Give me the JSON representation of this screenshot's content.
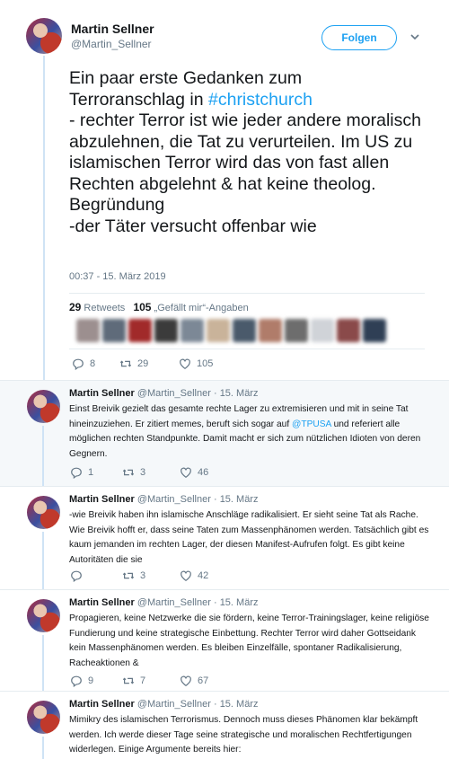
{
  "main": {
    "name": "Martin Sellner",
    "handle": "@Martin_Sellner",
    "follow_label": "Folgen",
    "text_before": "Ein paar erste Gedanken zum\nTerroranschlag in ",
    "hashtag": "#christchurch",
    "text_after": "\n- rechter Terror ist wie jeder andere moralisch abzulehnen, die Tat zu verurteilen. Im US zu islamischen Terror wird das von fast allen Rechten abgelehnt & hat keine theolog. Begründung\n-der Täter versucht offenbar wie",
    "timestamp": "00:37 - 15. März 2019",
    "retweets_count": "29",
    "retweets_label": "Retweets",
    "likes_count": "105",
    "likes_label": "„Gefällt mir“-Angaben",
    "reply_count": "8",
    "retweet_count": "29",
    "like_count": "105",
    "liker_colors": [
      "#9c8f8f",
      "#5f6b7a",
      "#a12a2a",
      "#3b3b3b",
      "#7c8896",
      "#c9b39a",
      "#4a5a6b",
      "#b07c6a",
      "#6d6d6d",
      "#d0d3d8",
      "#8a4a4a",
      "#2f3f55"
    ]
  },
  "replies": [
    {
      "name": "Martin Sellner",
      "handle": "@Martin_Sellner",
      "date": "· 15. März",
      "text_before": "Einst Breivik gezielt das gesamte rechte Lager zu extremisieren und mit in seine Tat hineinzuziehen. Er zitiert memes, beruft sich sogar auf ",
      "mention": "@TPUSA",
      "text_after": " und referiert alle möglichen rechten Standpunkte. Damit macht er sich zum nützlichen Idioten von deren Gegnern.",
      "reply_count": "1",
      "retweet_count": "3",
      "like_count": "46"
    },
    {
      "name": "Martin Sellner",
      "handle": "@Martin_Sellner",
      "date": "· 15. März",
      "text": "-wie Breivik haben ihn islamische Anschläge radikalisiert. Er sieht seine Tat als Rache. Wie Breivik hofft er, dass seine Taten zum Massenphänomen werden. Tatsächlich gibt es kaum jemanden im rechten Lager, der diesen Manifest-Aufrufen folgt. Es gibt keine Autoritäten die sie",
      "reply_count": "",
      "retweet_count": "3",
      "like_count": "42"
    },
    {
      "name": "Martin Sellner",
      "handle": "@Martin_Sellner",
      "date": "· 15. März",
      "text": "Propagieren, keine Netzwerke die sie fördern, keine Terror-Trainingslager, keine religiöse Fundierung und keine strategische Einbettung. Rechter Terror wird daher Gottseidank kein Massenphänomen werden. Es bleiben Einzelfälle, spontaner Radikalisierung, Racheaktionen &",
      "reply_count": "9",
      "retweet_count": "7",
      "like_count": "67"
    },
    {
      "name": "Martin Sellner",
      "handle": "@Martin_Sellner",
      "date": "· 15. März",
      "text": "Mimikry des islamischen Terrorismus. Dennoch muss dieses Phänomen klar bekämpft werden. Ich werde dieser Tage seine strategische und moralischen Rechtfertigungen widerlegen. Einige Argumente bereits hier:"
    }
  ]
}
